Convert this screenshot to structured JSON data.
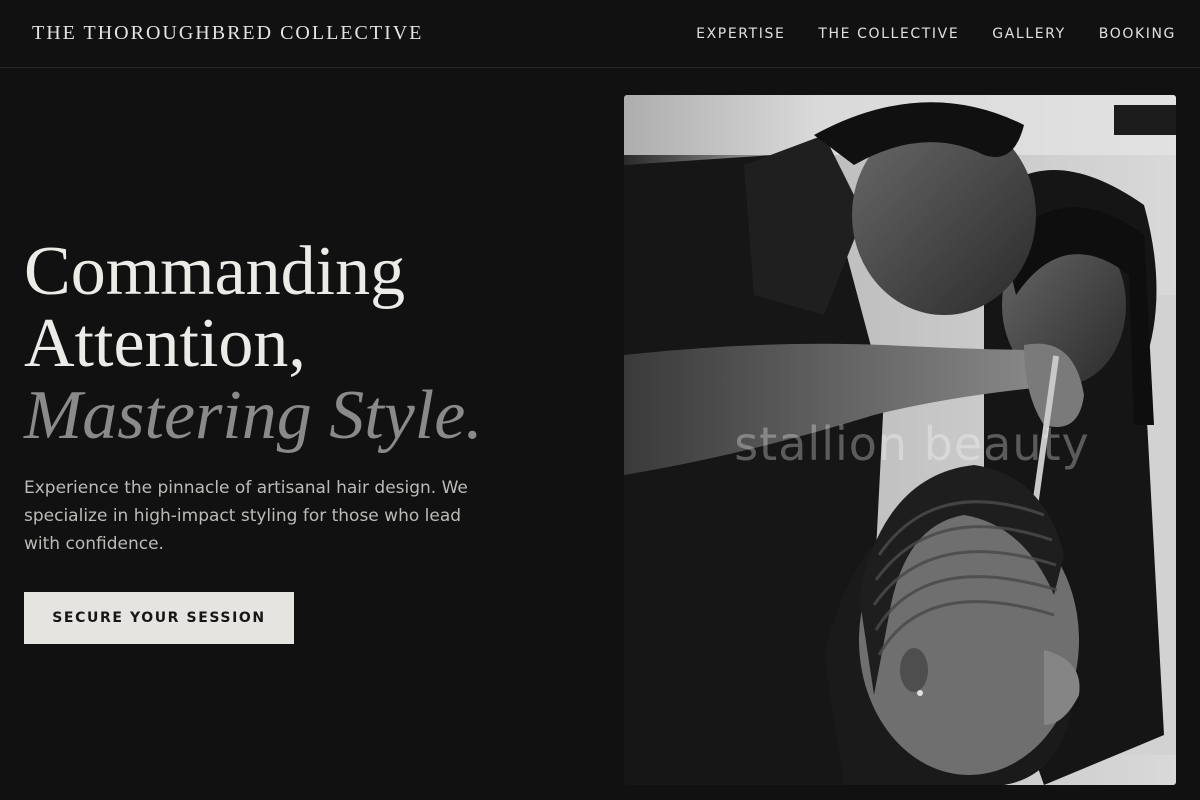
{
  "header": {
    "brand": "THE THOROUGHBRED COLLECTIVE",
    "nav": [
      "EXPERTISE",
      "THE COLLECTIVE",
      "GALLERY",
      "BOOKING"
    ]
  },
  "hero": {
    "headline_line1": "Commanding",
    "headline_line2": "Attention,",
    "headline_accent": "Mastering Style.",
    "description": "Experience the pinnacle of artisanal hair design. We specialize in high-impact styling for those who lead with confidence.",
    "cta_label": "SECURE YOUR SESSION"
  },
  "photo": {
    "subject": "black-and-white photo of stylists braiding cornrows on a client",
    "watermark": "stallion beauty"
  },
  "colors": {
    "background": "#111111",
    "text": "#e8e6e3",
    "accent_text": "#8a8a8a",
    "button_bg": "#e6e4e1",
    "button_text": "#161616"
  }
}
